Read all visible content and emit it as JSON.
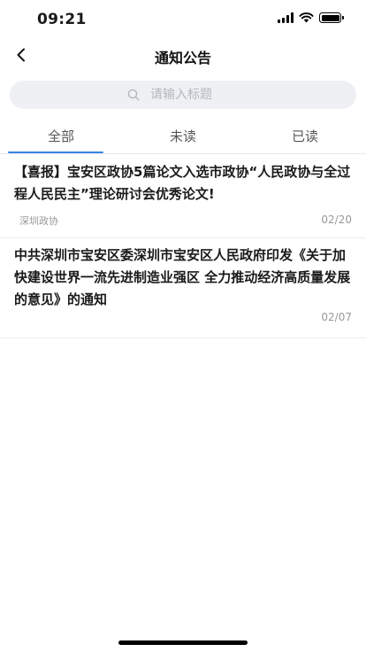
{
  "status_bar": {
    "time": "09:21"
  },
  "header": {
    "title": "通知公告",
    "back_icon": "chevron-left-icon"
  },
  "search": {
    "placeholder": "请输入标题",
    "value": "",
    "icon": "search-icon"
  },
  "tabs": [
    {
      "label": "全部",
      "active": true
    },
    {
      "label": "未读",
      "active": false
    },
    {
      "label": "已读",
      "active": false
    }
  ],
  "notices": [
    {
      "title": "【喜报】宝安区政协5篇论文入选市政协“人民政协与全过程人民民主”理论研讨会优秀论文!",
      "source": "深圳政协",
      "date": "02/20"
    },
    {
      "title": "中共深圳市宝安区委深圳市宝安区人民政府印发《关于加快建设世界一流先进制造业强区 全力推动经济高质量发展的意见》的通知",
      "source": "",
      "date": "02/07"
    }
  ],
  "colors": {
    "accent": "#3b82e6",
    "search_bg": "#eef0f3",
    "muted_text": "#999999"
  }
}
